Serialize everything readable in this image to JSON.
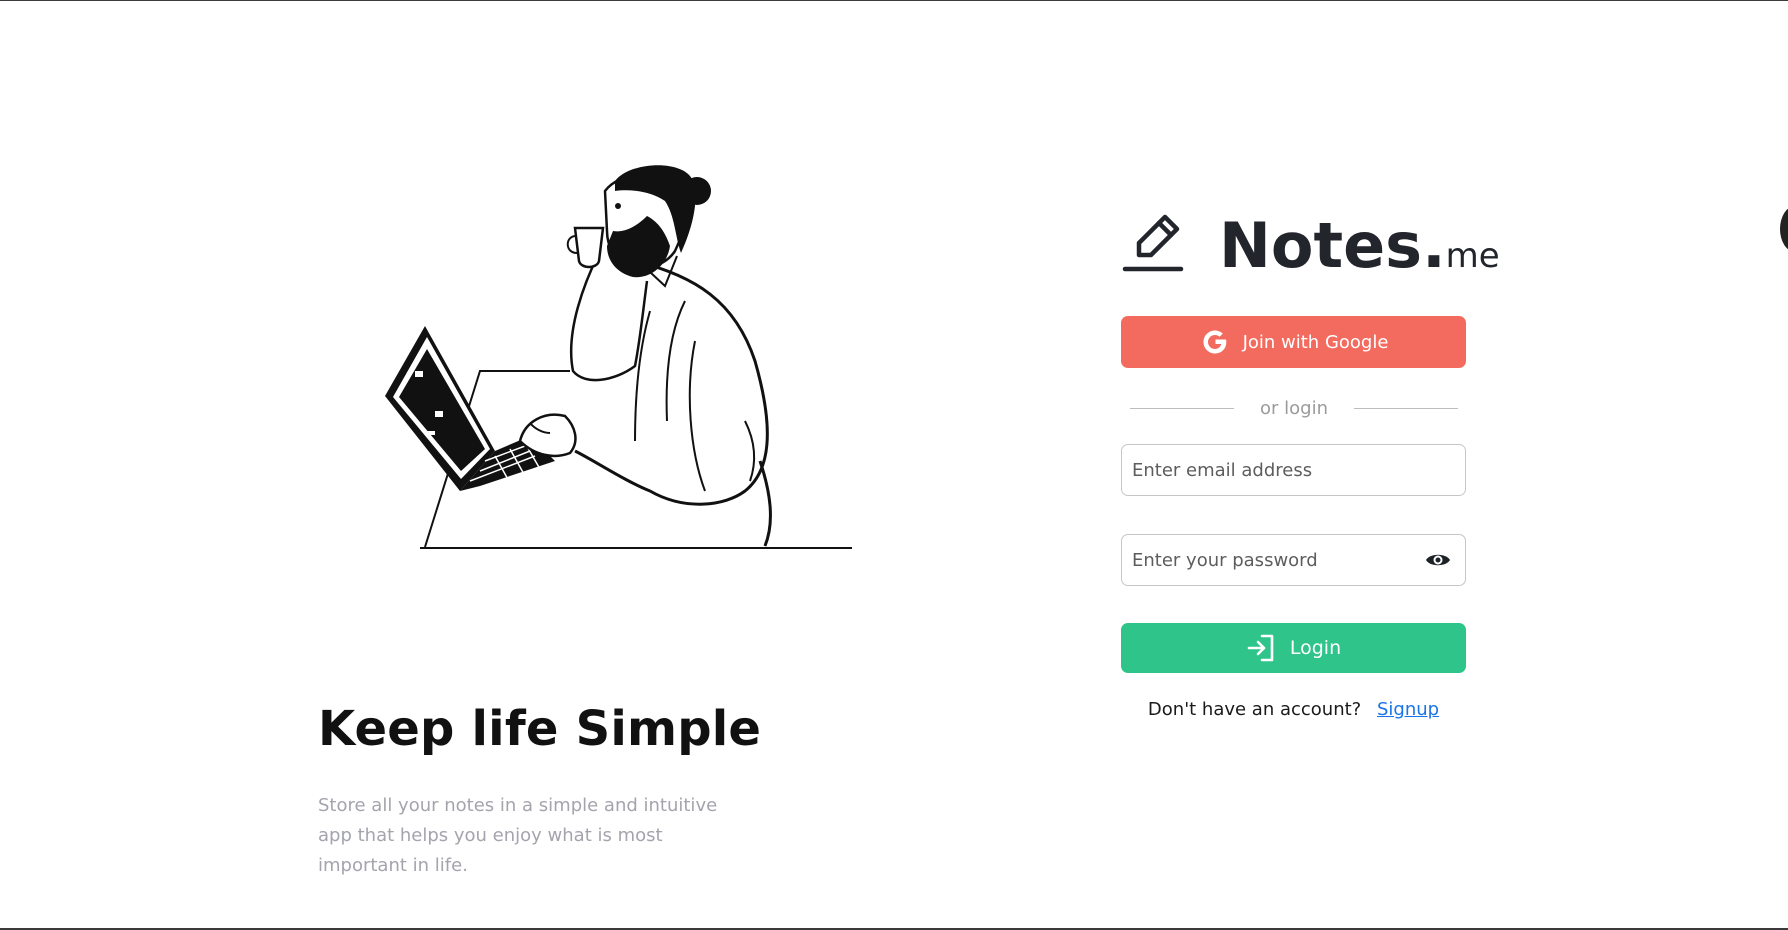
{
  "hero": {
    "headline": "Keep life Simple",
    "description": "Store all your notes in a simple and intuitive app that helps you enjoy what is most important in life."
  },
  "logo": {
    "icon": "pencil-icon",
    "word": "Notes.",
    "suffix": "me"
  },
  "auth": {
    "google_button_label": "Join with Google",
    "google_icon": "google-g-icon",
    "divider_label": "or login",
    "email_placeholder": "Enter email address",
    "password_placeholder": "Enter your password",
    "password_toggle_icon": "eye-icon",
    "login_button_label": "Login",
    "login_icon": "sign-in-icon",
    "signup_prompt": "Don't have an account?",
    "signup_link": "Signup"
  },
  "colors": {
    "google_button": "#f36b5f",
    "login_button": "#2ec48a",
    "link": "#1a73e8",
    "muted_text": "#a4a4ad"
  }
}
